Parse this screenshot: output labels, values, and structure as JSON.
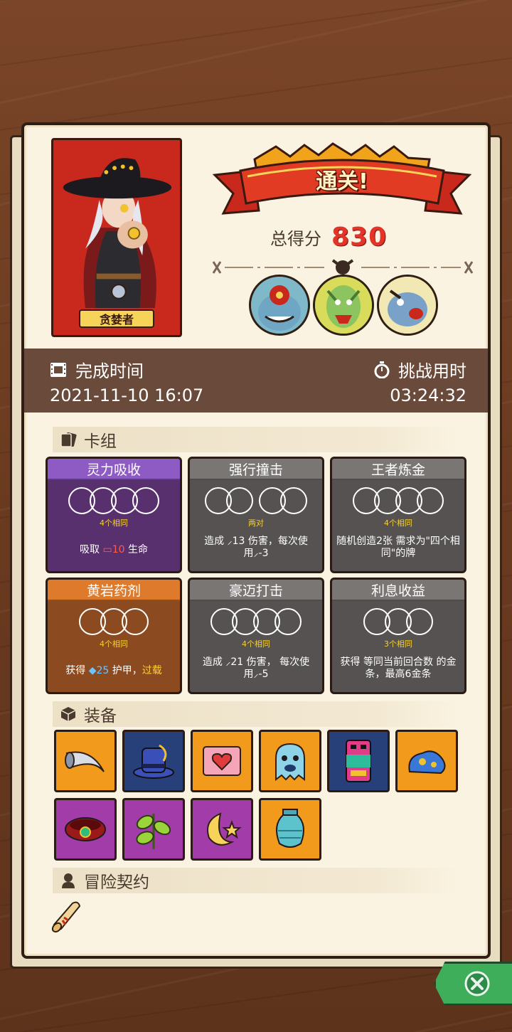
{
  "hero": {
    "name": "贪婪者"
  },
  "result": {
    "banner": "通关!",
    "score_label": "总得分",
    "score_value": "830"
  },
  "stats": {
    "finish_time_label": "完成时间",
    "finish_time_value": "2021-11-10 16:07",
    "challenge_time_label": "挑战用时",
    "challenge_time_value": "03:24:32"
  },
  "sections": {
    "deck": "卡组",
    "equipment": "装备",
    "contract": "冒险契约"
  },
  "cards": [
    {
      "title": "灵力吸收",
      "req": "4个相同",
      "desc_pre": "吸取 ",
      "desc_value": "10",
      "desc_post": " 生命",
      "color": "purple"
    },
    {
      "title": "强行撞击",
      "req": "两对",
      "desc": "造成 ⸝13 伤害，每次使用⸝-3",
      "color": "gray"
    },
    {
      "title": "王者炼金",
      "req": "4个相同",
      "desc": "随机创造2张 需求为\"四个相同\"的牌",
      "color": "gray"
    },
    {
      "title": "黄岩药剂",
      "req": "4个相同",
      "desc_pre": "获得 ",
      "desc_value": "25",
      "desc_mid": " 护甲，",
      "desc_keyword": "过载",
      "color": "orange"
    },
    {
      "title": "豪迈打击",
      "req": "4个相同",
      "desc": "造成 ⸝21 伤害， 每次使用⸝-5",
      "color": "gray"
    },
    {
      "title": "利息收益",
      "req": "3个相同",
      "desc": "获得 等同当前回合数 的金条，最高6金条",
      "color": "gray"
    }
  ],
  "equipment": [
    {
      "icon": "horn-icon",
      "bg": "#f19a1c"
    },
    {
      "icon": "top-hat-icon",
      "bg": "#27407a"
    },
    {
      "icon": "heart-box-icon",
      "bg": "#f19a1c"
    },
    {
      "icon": "ghost-icon",
      "bg": "#f19a1c"
    },
    {
      "icon": "totem-icon",
      "bg": "#27407a"
    },
    {
      "icon": "blue-slime-icon",
      "bg": "#f19a1c"
    },
    {
      "icon": "collar-icon",
      "bg": "#a23ca8"
    },
    {
      "icon": "leaf-icon",
      "bg": "#a23ca8"
    },
    {
      "icon": "moon-star-icon",
      "bg": "#a23ca8"
    },
    {
      "icon": "urn-icon",
      "bg": "#f19a1c"
    }
  ],
  "colors": {
    "score": "#e4342a",
    "close_button": "#3fae5a",
    "stats_bar": "#6a4a3a"
  }
}
